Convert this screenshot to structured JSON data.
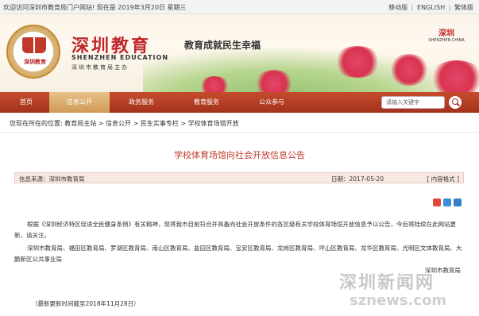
{
  "topbar": {
    "welcome": "欢迎访问深圳市教育局门户网站! 现在是 2019年3月20日 星期三",
    "links": [
      "移动版",
      "ENGLISH",
      "繁体版"
    ]
  },
  "header": {
    "logo_text": "深圳教育",
    "title_cn": "深圳教育",
    "title_en": "SHENZHEN EDUCATION",
    "title_sub": "深圳市教育局主办",
    "slogan": "教育成就民生幸福",
    "city_logo_text": "深圳",
    "city_logo_en": "SHENZHEN CHINA"
  },
  "nav": {
    "items": [
      "首页",
      "信息公开",
      "政务服务",
      "教育服务",
      "公众参与"
    ],
    "active_index": 1,
    "search_placeholder": "请输入关键字"
  },
  "breadcrumb": {
    "prefix": "您现在所在的位置:",
    "items": [
      "教育局主站",
      "信息公开",
      "民生实事专栏",
      "学校体育场馆开放"
    ],
    "separator": ">"
  },
  "article": {
    "title": "学校体育场馆向社会开放信息公告",
    "source_label": "信息来源：",
    "source": "深圳市教育局",
    "date_label": "日期：",
    "date": "2017-05-20",
    "size_label": "[ 内容格式 ]",
    "paragraph1": "根据《深圳经济特区促进全民健身条例》有关精神，现将我市目前符合并具备向社会开放条件的各区级有关学校体育场馆开放信息予以公告，今后将陆续在此网站更新，请关注。",
    "paragraph2": "深圳市教育局、福田区教育局、罗湖区教育局、南山区教育局、盐田区教育局、宝安区教育局、龙岗区教育局、坪山区教育局、龙华区教育局、光明区文体教育局、大鹏新区公共事业局",
    "signature": "深圳市教育局",
    "updated": "（最新更新时间截至2018年11月28日）"
  },
  "watermark": {
    "line1": "深圳新闻网",
    "line2": "sznews.com"
  },
  "colors": {
    "nav_bg": "#b03a20",
    "nav_active": "#dcae6e",
    "title_red": "#c0392b"
  }
}
